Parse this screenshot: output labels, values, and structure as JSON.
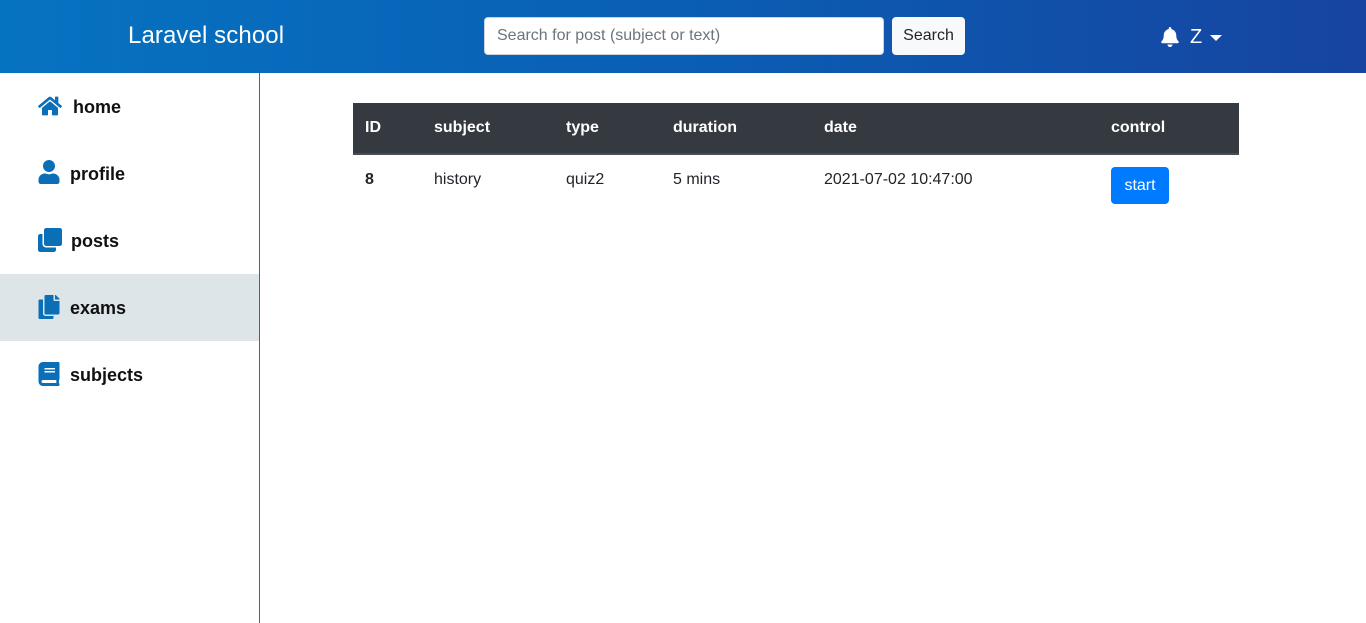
{
  "app": {
    "brand": "Laravel school"
  },
  "search": {
    "placeholder": "Search for post (subject or text)",
    "button_label": "Search"
  },
  "user": {
    "initial": "Z"
  },
  "sidebar": {
    "items": [
      {
        "label": "home",
        "icon": "home-icon"
      },
      {
        "label": "profile",
        "icon": "user-icon"
      },
      {
        "label": "posts",
        "icon": "clone-icon"
      },
      {
        "label": "exams",
        "icon": "copy-icon",
        "active": true
      },
      {
        "label": "subjects",
        "icon": "book-icon"
      }
    ]
  },
  "exams_table": {
    "headers": [
      "ID",
      "subject",
      "type",
      "duration",
      "date",
      "control"
    ],
    "rows": [
      {
        "id": "8",
        "subject": "history",
        "type": "quiz2",
        "duration": "5 mins",
        "date": "2021-07-02 10:47:00",
        "control": "start"
      }
    ]
  },
  "colors": {
    "accent": "#007bff",
    "brand_start": "#0673c1",
    "brand_end": "#1644a0",
    "icon": "#0b6fb8"
  }
}
